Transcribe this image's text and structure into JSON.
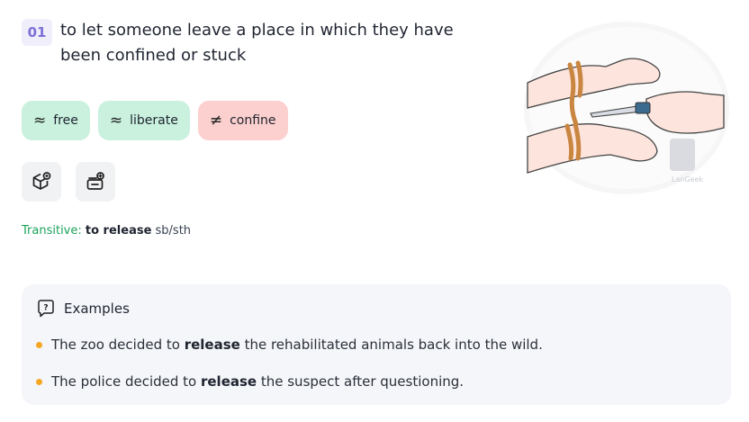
{
  "sense": {
    "number": "01",
    "definition": "to let someone leave a place in which they have been confined or stuck"
  },
  "related_words": [
    {
      "symbol": "≈",
      "word": "free",
      "relation": "synonym",
      "color": "#c9f1de"
    },
    {
      "symbol": "≈",
      "word": "liberate",
      "relation": "synonym",
      "color": "#c9f1de"
    },
    {
      "symbol": "≠",
      "word": "confine",
      "relation": "antonym",
      "color": "#fbd0ce"
    }
  ],
  "action_icons": [
    "cube-icon",
    "save-to-list-icon"
  ],
  "grammar": {
    "type": "Transitive:",
    "pattern": "to release",
    "object": " sb/sth"
  },
  "examples": {
    "heading": "Examples",
    "items": [
      {
        "before": "The zoo decided to ",
        "keyword": "release",
        "after": " the rehabilitated animals back into the wild."
      },
      {
        "before": "The police decided to ",
        "keyword": "release",
        "after": " the suspect after questioning."
      }
    ]
  },
  "illustration": {
    "subject": "hands cutting rope binding wrists with a knife",
    "watermark": "LanGeek"
  },
  "colors": {
    "accent_purple": "#7c6fd6",
    "synonym_bg": "#c9f1de",
    "antonym_bg": "#fbd0ce",
    "grammar_green": "#1aa35a",
    "bullet_orange": "#f5a623",
    "examples_bg": "#f5f6f9"
  }
}
